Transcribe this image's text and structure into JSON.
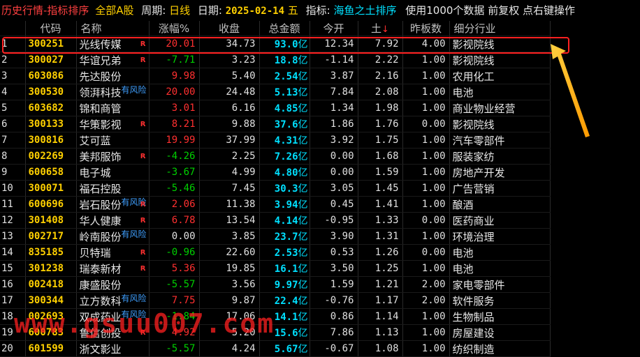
{
  "topbar": {
    "title": "历史行情-指标排序",
    "scope": "全部A股",
    "period_label": "周期:",
    "period_value": "日线",
    "date_label": "日期:",
    "date_value": "2025-02-14",
    "weekday": "五",
    "indicator_label": "指标:",
    "indicator_value": "海鱼之土排序",
    "note": "使用1000个数据 前复权 点右键操作"
  },
  "columns": [
    "代码",
    "名称",
    "涨幅%",
    "收盘",
    "总金额",
    "今开",
    "土",
    "昨板数",
    "细分行业"
  ],
  "sort_marker": "↓",
  "amount_unit": "亿",
  "risk_text": "有风险",
  "flag_text": "R",
  "rows": [
    {
      "idx": "1",
      "code": "300251",
      "name": "光线传媒",
      "flag": "R",
      "risk": "",
      "chg": "20.01",
      "dir": "up",
      "close": "34.73",
      "amt": "93.0",
      "open": "12.34",
      "tu": "7.92",
      "zb": "4.00",
      "ind": "影视院线"
    },
    {
      "idx": "2",
      "code": "300027",
      "name": "华谊兄弟",
      "flag": "R",
      "risk": "",
      "chg": "-7.71",
      "dir": "down",
      "close": "3.23",
      "amt": "18.8",
      "open": "-1.14",
      "tu": "2.22",
      "zb": "1.00",
      "ind": "影视院线"
    },
    {
      "idx": "3",
      "code": "603086",
      "name": "先达股份",
      "flag": "",
      "risk": "",
      "chg": "9.98",
      "dir": "up",
      "close": "5.40",
      "amt": "2.54",
      "open": "3.87",
      "tu": "2.16",
      "zb": "1.00",
      "ind": "农用化工"
    },
    {
      "idx": "4",
      "code": "300530",
      "name": "领湃科技",
      "flag": "",
      "risk": "有风险",
      "chg": "20.00",
      "dir": "up",
      "close": "24.48",
      "amt": "5.13",
      "open": "7.84",
      "tu": "2.08",
      "zb": "1.00",
      "ind": "电池"
    },
    {
      "idx": "5",
      "code": "603682",
      "name": "锦和商管",
      "flag": "",
      "risk": "",
      "chg": "3.01",
      "dir": "up",
      "close": "6.16",
      "amt": "4.85",
      "open": "1.34",
      "tu": "1.98",
      "zb": "1.00",
      "ind": "商业物业经营"
    },
    {
      "idx": "6",
      "code": "300133",
      "name": "华策影视",
      "flag": "R",
      "risk": "",
      "chg": "8.21",
      "dir": "up",
      "close": "9.88",
      "amt": "37.6",
      "open": "1.86",
      "tu": "1.76",
      "zb": "0.00",
      "ind": "影视院线"
    },
    {
      "idx": "7",
      "code": "300816",
      "name": "艾可蓝",
      "flag": "",
      "risk": "",
      "chg": "19.99",
      "dir": "up",
      "close": "37.99",
      "amt": "4.31",
      "open": "3.92",
      "tu": "1.75",
      "zb": "1.00",
      "ind": "汽车零部件"
    },
    {
      "idx": "8",
      "code": "002269",
      "name": "美邦服饰",
      "flag": "R",
      "risk": "",
      "chg": "-4.26",
      "dir": "down",
      "close": "2.25",
      "amt": "7.26",
      "open": "0.00",
      "tu": "1.68",
      "zb": "1.00",
      "ind": "服装家纺"
    },
    {
      "idx": "9",
      "code": "600658",
      "name": "电子城",
      "flag": "",
      "risk": "",
      "chg": "-3.67",
      "dir": "down",
      "close": "4.99",
      "amt": "4.80",
      "open": "0.00",
      "tu": "1.59",
      "zb": "1.00",
      "ind": "房地产开发"
    },
    {
      "idx": "10",
      "code": "300071",
      "name": "福石控股",
      "flag": "",
      "risk": "",
      "chg": "-5.46",
      "dir": "down",
      "close": "7.45",
      "amt": "30.3",
      "open": "3.05",
      "tu": "1.45",
      "zb": "1.00",
      "ind": "广告营销"
    },
    {
      "idx": "11",
      "code": "600696",
      "name": "岩石股份",
      "flag": "R",
      "risk": "有风险",
      "chg": "2.06",
      "dir": "up",
      "close": "11.38",
      "amt": "3.94",
      "open": "0.45",
      "tu": "1.41",
      "zb": "1.00",
      "ind": "酿酒"
    },
    {
      "idx": "12",
      "code": "301408",
      "name": "华人健康",
      "flag": "R",
      "risk": "",
      "chg": "6.78",
      "dir": "up",
      "close": "13.54",
      "amt": "4.14",
      "open": "-0.95",
      "tu": "1.33",
      "zb": "0.00",
      "ind": "医药商业"
    },
    {
      "idx": "13",
      "code": "002717",
      "name": "岭南股份",
      "flag": "",
      "risk": "有风险",
      "chg": "0.00",
      "dir": "flat",
      "close": "3.85",
      "amt": "23.7",
      "open": "3.90",
      "tu": "1.31",
      "zb": "1.00",
      "ind": "环境治理"
    },
    {
      "idx": "14",
      "code": "835185",
      "name": "贝特瑞",
      "flag": "R",
      "risk": "",
      "chg": "-0.96",
      "dir": "down",
      "close": "22.60",
      "amt": "2.53",
      "open": "0.53",
      "tu": "1.26",
      "zb": "0.00",
      "ind": "电池"
    },
    {
      "idx": "15",
      "code": "301238",
      "name": "瑞泰新材",
      "flag": "R",
      "risk": "",
      "chg": "5.36",
      "dir": "up",
      "close": "19.85",
      "amt": "16.1",
      "open": "3.50",
      "tu": "1.25",
      "zb": "1.00",
      "ind": "电池"
    },
    {
      "idx": "16",
      "code": "002418",
      "name": "康盛股份",
      "flag": "",
      "risk": "",
      "chg": "-5.57",
      "dir": "down",
      "close": "3.56",
      "amt": "9.97",
      "open": "1.59",
      "tu": "1.21",
      "zb": "2.00",
      "ind": "家电零部件"
    },
    {
      "idx": "17",
      "code": "300344",
      "name": "立方数科",
      "flag": "",
      "risk": "有风险",
      "chg": "7.75",
      "dir": "up",
      "close": "9.87",
      "amt": "22.4",
      "open": "-0.76",
      "tu": "1.17",
      "zb": "2.00",
      "ind": "软件服务"
    },
    {
      "idx": "18",
      "code": "002693",
      "name": "双成药业",
      "flag": "",
      "risk": "有风险",
      "chg": "-1.84",
      "dir": "down",
      "close": "17.06",
      "amt": "14.1",
      "open": "0.86",
      "tu": "1.14",
      "zb": "1.00",
      "ind": "生物制品"
    },
    {
      "idx": "19",
      "code": "600783",
      "name": "鲁信创投",
      "flag": "R",
      "risk": "",
      "chg": "4.92",
      "dir": "up",
      "close": "5.20",
      "amt": "15.6",
      "open": "7.86",
      "tu": "1.13",
      "zb": "1.00",
      "ind": "房屋建设"
    },
    {
      "idx": "20",
      "code": "601599",
      "name": "浙文影业",
      "flag": "",
      "risk": "",
      "chg": "-5.57",
      "dir": "down",
      "close": "4.24",
      "amt": "5.67",
      "open": "-0.67",
      "tu": "1.08",
      "zb": "1.00",
      "ind": "纺织制造"
    }
  ],
  "watermark": "www.gsuu007.com",
  "colors": {
    "up": "#ff3030",
    "down": "#00d000",
    "code": "#ffd000",
    "amount": "#00e0ff",
    "highlight": "#ff2020",
    "arrow": "#ffb000"
  }
}
